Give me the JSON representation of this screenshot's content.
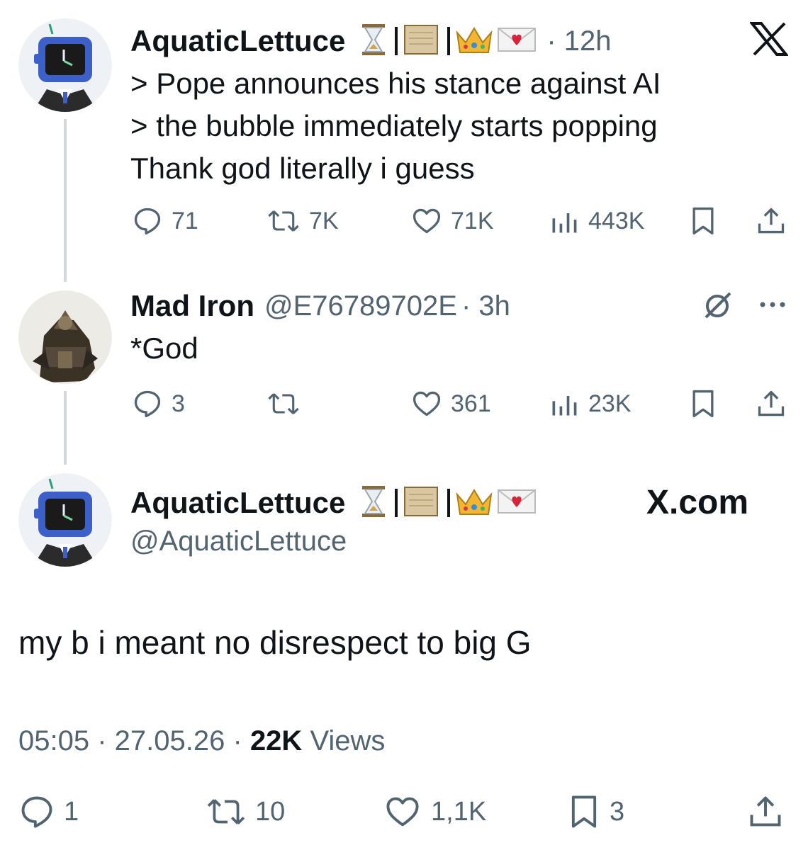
{
  "tweet1": {
    "author": "AquaticLettuce",
    "time": "· 12h",
    "lines": [
      "> Pope announces his stance against AI",
      "> the bubble immediately starts popping",
      "Thank god literally i guess"
    ],
    "replies": "71",
    "retweets": "7K",
    "likes": "71K",
    "views": "443K"
  },
  "tweet2": {
    "author": "Mad Iron",
    "handle": "@E76789702E",
    "time": "· 3h",
    "text": "*God",
    "replies": "3",
    "likes": "361",
    "views": "23K"
  },
  "main": {
    "author": "AquaticLettuce",
    "handle": "@AquaticLettuce",
    "brand": "X.com",
    "text": "my b i meant no disrespect to big G",
    "time": "05:05",
    "date": "27.05.26",
    "views_count": "22K",
    "views_label": "Views",
    "replies": "1",
    "retweets": "10",
    "likes": "1,1K",
    "bookmarks": "3"
  },
  "colors": {
    "text": "#0f1419",
    "muted": "#536471",
    "line": "#cfd9de"
  }
}
